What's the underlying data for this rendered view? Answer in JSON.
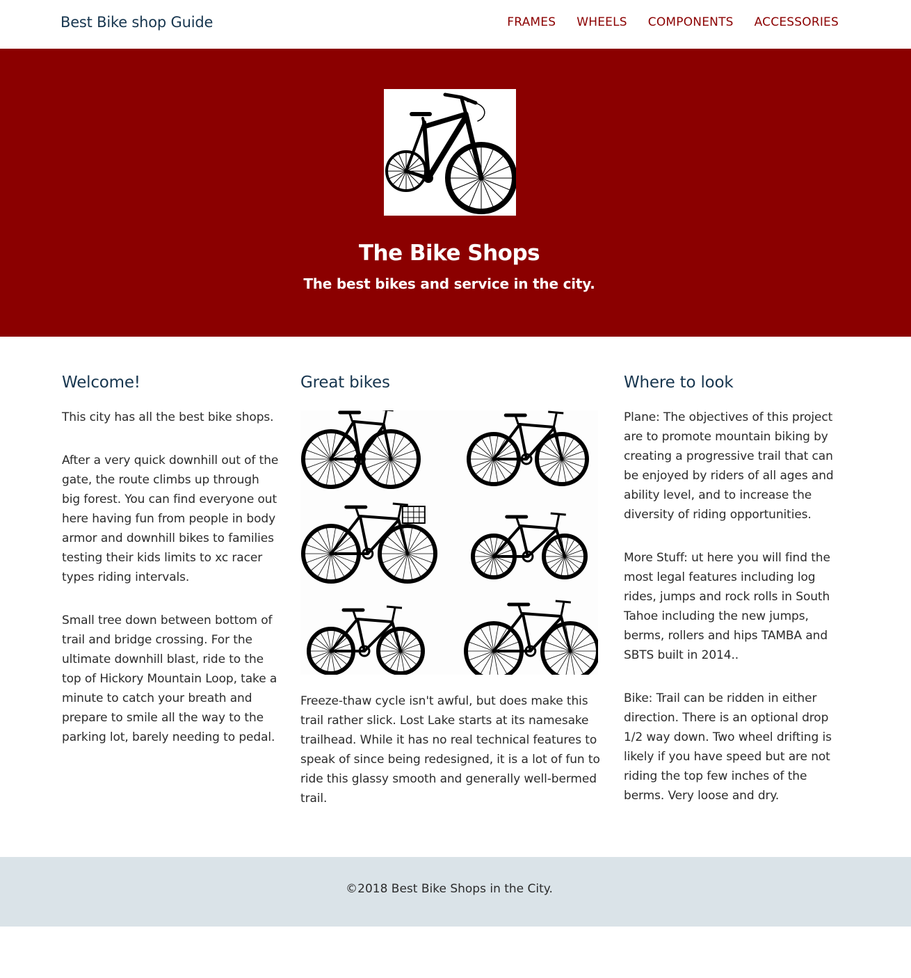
{
  "nav": {
    "brand": "Best Bike shop Guide",
    "links": [
      "FRAMES",
      "WHEELS",
      "COMPONENTS",
      "ACCESSORIES"
    ]
  },
  "hero": {
    "image": "bicycle-silhouette",
    "title": "The Bike Shops",
    "subtitle": "The best bikes and service in the city."
  },
  "columns": [
    {
      "heading": "Welcome!",
      "paragraphs": [
        "This city has all the best bike shops.",
        "After a very quick downhill out of the gate, the route climbs up through big forest. You can find everyone out here having fun from people in body armor and downhill bikes to families testing their kids limits to xc racer types riding intervals.",
        "Small tree down between bottom of trail and bridge crossing. For the ultimate downhill blast, ride to the top of Hickory Mountain Loop, take a minute to catch your breath and prepare to smile all the way to the parking lot, barely needing to pedal."
      ]
    },
    {
      "heading": "Great bikes",
      "image": "six-bicycles-grid",
      "paragraphs": [
        "Freeze-thaw cycle isn't awful, but does make this trail rather slick. Lost Lake starts at its namesake trailhead. While it has no real technical features to speak of since being redesigned, it is a lot of fun to ride this glassy smooth and generally well-bermed trail."
      ]
    },
    {
      "heading": "Where to look",
      "paragraphs": [
        "Plane: The objectives of this project are to promote mountain biking by creating a progressive trail that can be enjoyed by riders of all ages and ability level, and to increase the diversity of riding opportunities.",
        "More Stuff: ut here you will find the most legal features including log rides, jumps and rock rolls in South Tahoe including the new jumps, berms, rollers and hips TAMBA and SBTS built in 2014..",
        "Bike: Trail can be ridden in either direction. There is an optional drop 1/2 way down. Two wheel drifting is likely if you have speed but are not riding the top few inches of the berms. Very loose and dry."
      ]
    }
  ],
  "footer": {
    "text": "©2018 Best Bike Shops in the City."
  },
  "colors": {
    "brand_red": "#8b0000",
    "heading_navy": "#17364f",
    "footer_bg": "#dae3e8"
  }
}
